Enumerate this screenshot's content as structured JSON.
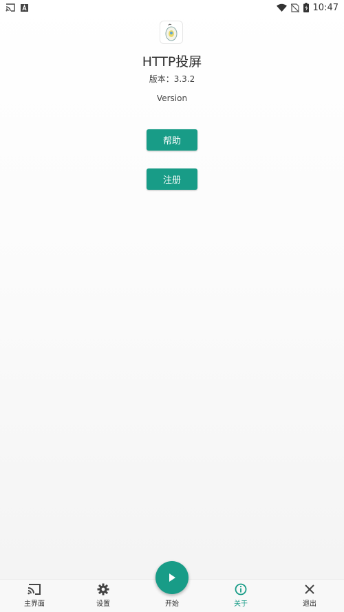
{
  "status_bar": {
    "time": "10:47",
    "icons": [
      "cast-icon",
      "a-icon",
      "wifi-icon",
      "no-sim-icon",
      "battery-icon"
    ]
  },
  "app": {
    "name": "HTTP投屏",
    "version_label": "版本：3.3.2",
    "version_word": "Version"
  },
  "buttons": {
    "help": "帮助",
    "register": "注册"
  },
  "bottom_nav": {
    "items": [
      {
        "label": "主界面",
        "icon": "cast-icon"
      },
      {
        "label": "设置",
        "icon": "gear-icon"
      },
      {
        "label": "开始",
        "icon": "play-icon"
      },
      {
        "label": "关于",
        "icon": "info-icon"
      },
      {
        "label": "退出",
        "icon": "close-icon"
      }
    ],
    "active": "关于"
  },
  "colors": {
    "accent": "#189c87",
    "text": "#333333",
    "background": "#ffffff"
  }
}
